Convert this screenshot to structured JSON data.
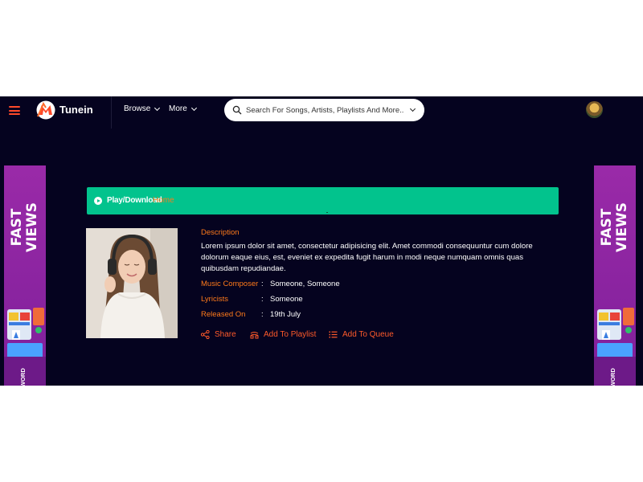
{
  "header": {
    "brand": "Tunein",
    "nav": [
      {
        "label": "Browse"
      },
      {
        "label": "More"
      }
    ],
    "search": {
      "placeholder": "Search For Songs, Artists, Playlists And More.."
    }
  },
  "side_ads": {
    "left": {
      "title_line1": "FAST",
      "title_line2": "VIEWS",
      "footer": "WORD"
    },
    "right": {
      "title_line1": "FAST",
      "title_line2": "VIEWS",
      "footer": "WORD"
    }
  },
  "breadcrumb": {
    "current": "Play/Download",
    "home": "Home"
  },
  "song": {
    "description_heading": "Description",
    "description": "Lorem ipsum dolor sit amet, consectetur adipisicing elit. Amet commodi consequuntur cum dolore dolorum eaque eius, est, eveniet ex expedita fugit harum in modi neque numquam omnis quas quibusdam repudiandae.",
    "meta": [
      {
        "label": "Music Composer",
        "value": "Someone, Someone"
      },
      {
        "label": "Lyricists",
        "value": "Someone"
      },
      {
        "label": "Released On",
        "value": "19th July"
      }
    ],
    "separator": ":",
    "actions": {
      "share": "Share",
      "add_to_playlist": "Add To Playlist",
      "add_to_queue": "Add To Queue"
    }
  },
  "colors": {
    "background": "#05031f",
    "accent": "#ff7a1a",
    "action": "#ff5a2a",
    "bar": "#02c38d",
    "ad": "#9a2aa8"
  },
  "icons": [
    "hamburger-icon",
    "tunein-logo",
    "search-icon",
    "chevron-down-icon",
    "play-circle-icon",
    "share-icon",
    "add-playlist-icon",
    "queue-icon"
  ]
}
